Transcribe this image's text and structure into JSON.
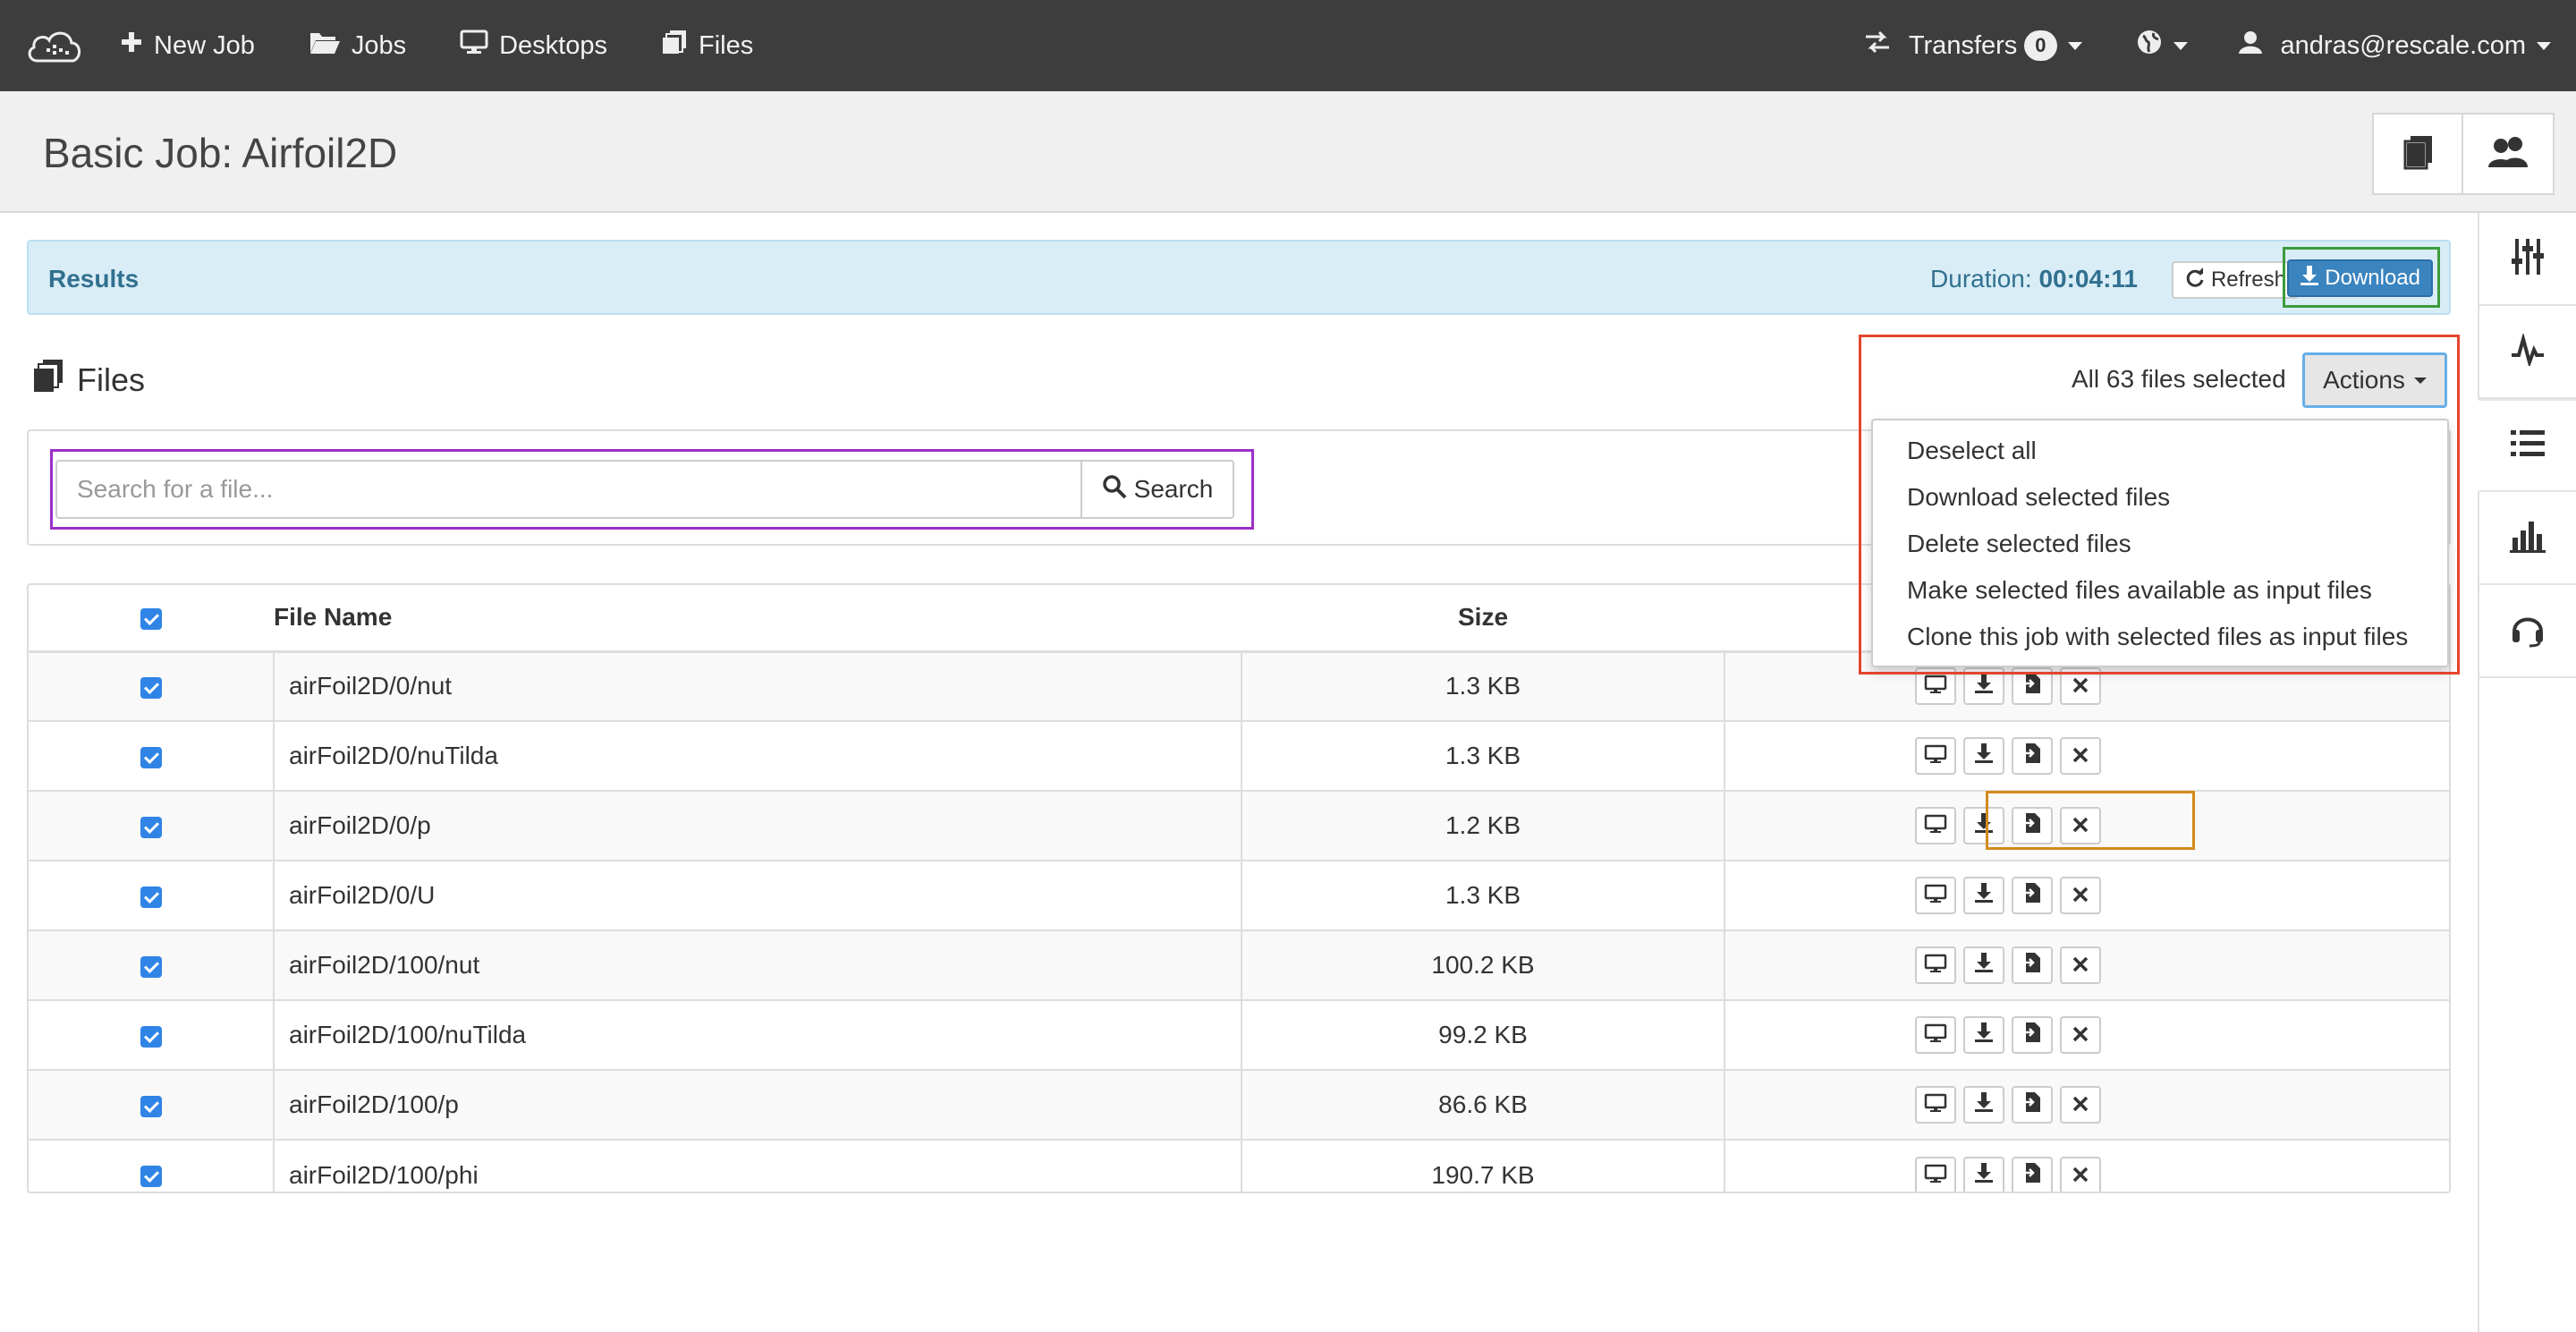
{
  "navbar": {
    "logo": "rescale-cloud-logo",
    "new_job": "New Job",
    "jobs": "Jobs",
    "desktops": "Desktops",
    "files": "Files",
    "transfers": "Transfers",
    "transfers_count": "0",
    "user": "andras@rescale.com"
  },
  "page": {
    "title": "Basic Job: Airfoil2D"
  },
  "results": {
    "label": "Results",
    "duration_label": "Duration: ",
    "duration_value": "00:04:11",
    "refresh": "Refresh",
    "download": "Download"
  },
  "files": {
    "heading": "Files",
    "selected_text": "All 63 files selected",
    "actions": "Actions",
    "menu": [
      "Deselect all",
      "Download selected files",
      "Delete selected files",
      "Make selected files available as input files",
      "Clone this job with selected files as input files"
    ],
    "search_placeholder": "Search for a file...",
    "search_button": "Search"
  },
  "table": {
    "headers": {
      "name": "File Name",
      "size": "Size"
    },
    "rows": [
      {
        "name": "airFoil2D/0/nut",
        "size": "1.3 KB"
      },
      {
        "name": "airFoil2D/0/nuTilda",
        "size": "1.3 KB"
      },
      {
        "name": "airFoil2D/0/p",
        "size": "1.2 KB"
      },
      {
        "name": "airFoil2D/0/U",
        "size": "1.3 KB"
      },
      {
        "name": "airFoil2D/100/nut",
        "size": "100.2 KB"
      },
      {
        "name": "airFoil2D/100/nuTilda",
        "size": "99.2 KB"
      },
      {
        "name": "airFoil2D/100/p",
        "size": "86.6 KB"
      },
      {
        "name": "airFoil2D/100/phi",
        "size": "190.7 KB"
      }
    ]
  },
  "colors": {
    "navbar": "#3d3d3d",
    "results_bg": "#d9edf7",
    "accent_blue": "#3a84bf",
    "outline_red": "#e2452d",
    "outline_green": "#3c9c3c",
    "outline_purple": "#9b2fc8",
    "outline_orange": "#d48a1c"
  }
}
